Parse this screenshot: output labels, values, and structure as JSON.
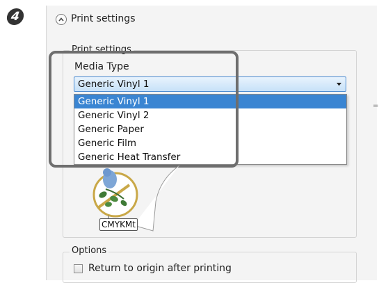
{
  "step_number": "4",
  "print_settings": {
    "title": "Print settings",
    "group_label": "Print settings",
    "media_type": {
      "label": "Media Type",
      "selected": "Generic Vinyl 1",
      "options": [
        "Generic Vinyl 1",
        "Generic Vinyl 2",
        "Generic Paper",
        "Generic Film",
        "Generic Heat Transfer"
      ]
    },
    "ink_config": "CMYKMt"
  },
  "options": {
    "group_label": "Options",
    "return_to_origin": {
      "label": "Return to origin after printing",
      "checked": false
    }
  },
  "colors": {
    "selection": "#3a85d2",
    "callout_frame": "#6e6e6e",
    "panel_bg": "#f4f4f4"
  },
  "icons": {
    "collapse": "chevron-up-icon",
    "dropdown": "chevron-down-icon",
    "thumbnail": "media-preview-icon"
  }
}
